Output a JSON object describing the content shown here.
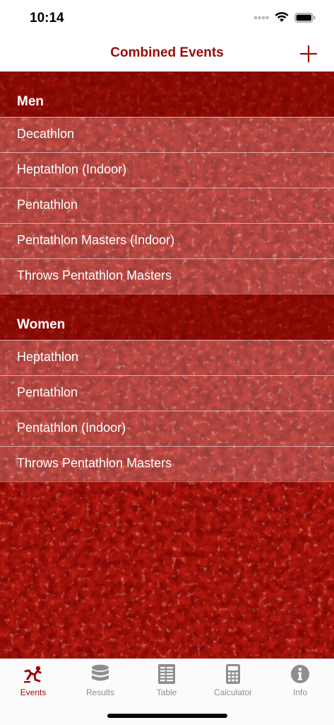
{
  "status_bar": {
    "time": "10:14"
  },
  "nav": {
    "title": "Combined Events",
    "add_icon": "plus-icon"
  },
  "colors": {
    "accent": "#9a0b0b",
    "track": "#b3170f",
    "inactive": "#8e8e8e"
  },
  "sections": [
    {
      "header": "Men",
      "items": [
        {
          "label": "Decathlon"
        },
        {
          "label": "Heptathlon (Indoor)"
        },
        {
          "label": "Pentathlon"
        },
        {
          "label": "Pentathlon Masters (Indoor)"
        },
        {
          "label": "Throws Pentathlon Masters"
        }
      ]
    },
    {
      "header": "Women",
      "items": [
        {
          "label": "Heptathlon"
        },
        {
          "label": "Pentathlon"
        },
        {
          "label": "Pentathlon (Indoor)"
        },
        {
          "label": "Throws Pentathlon Masters"
        }
      ]
    }
  ],
  "tabs": [
    {
      "label": "Events",
      "icon": "runner-icon",
      "active": true
    },
    {
      "label": "Results",
      "icon": "database-icon",
      "active": false
    },
    {
      "label": "Table",
      "icon": "table-icon",
      "active": false
    },
    {
      "label": "Calculator",
      "icon": "calculator-icon",
      "active": false
    },
    {
      "label": "Info",
      "icon": "info-icon",
      "active": false
    }
  ]
}
